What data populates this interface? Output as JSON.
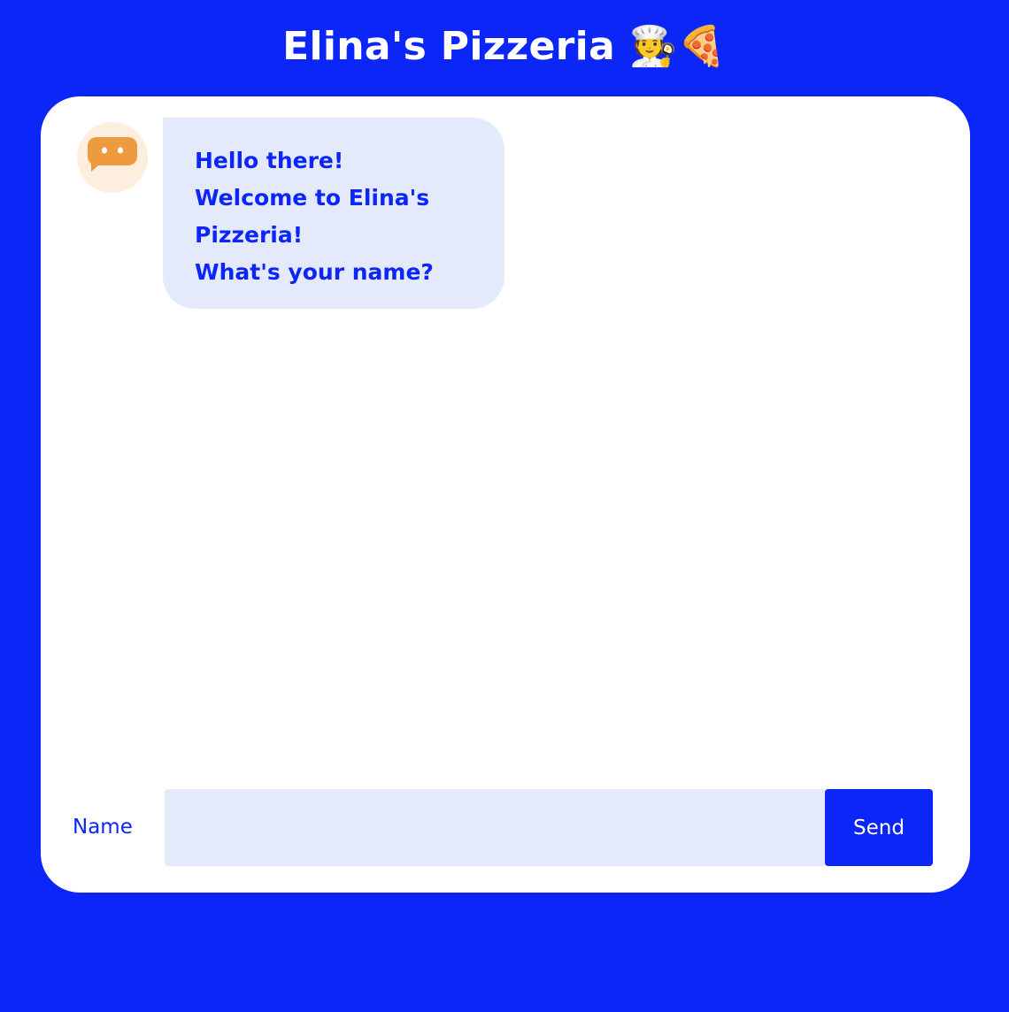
{
  "header": {
    "title": "Elina's Pizzeria 🧑‍🍳🍕"
  },
  "chat": {
    "bot_avatar_icon": "chat-bubble-icon",
    "messages": [
      {
        "sender": "bot",
        "lines": [
          "Hello there!",
          "Welcome to Elina's",
          "Pizzeria!",
          "What's your name?"
        ]
      }
    ]
  },
  "input": {
    "label": "Name",
    "value": "",
    "placeholder": "",
    "send_label": "Send"
  },
  "colors": {
    "background": "#0c26f8",
    "accent": "#0c26f8",
    "bubble": "#e5e9fc",
    "avatar_bg": "#fdeede",
    "avatar_icon": "#ee9a40"
  }
}
